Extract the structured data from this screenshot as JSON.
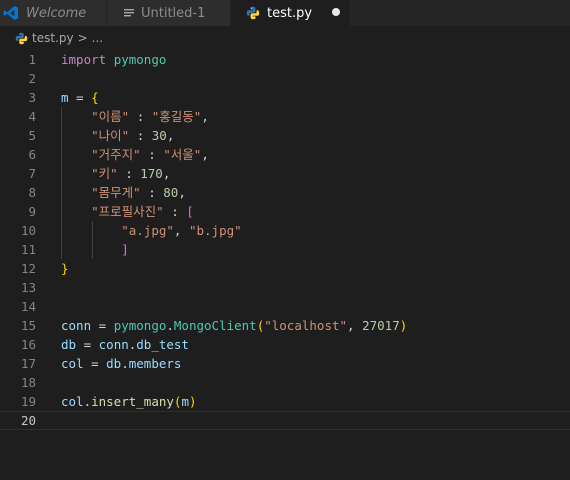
{
  "tabs": [
    {
      "label": "Welcome",
      "icon": "vscode-logo-icon",
      "active": false
    },
    {
      "label": "Untitled-1",
      "icon": "text-file-icon",
      "active": false
    },
    {
      "label": "test.py",
      "icon": "python-icon",
      "active": true,
      "dirty": true
    }
  ],
  "breadcrumb": {
    "file": "test.py",
    "separator": ">",
    "more": "..."
  },
  "editor": {
    "current_line": 20,
    "line_numbers": [
      "1",
      "2",
      "3",
      "4",
      "5",
      "6",
      "7",
      "8",
      "9",
      "10",
      "11",
      "12",
      "13",
      "14",
      "15",
      "16",
      "17",
      "18",
      "19",
      "20"
    ],
    "lines": [
      [
        {
          "t": "import",
          "c": "kw"
        },
        {
          "t": " "
        },
        {
          "t": "pymongo",
          "c": "mod"
        }
      ],
      [],
      [
        {
          "t": "m",
          "c": "var"
        },
        {
          "t": " = ",
          "c": "op"
        },
        {
          "t": "{",
          "c": "b1"
        }
      ],
      [
        {
          "t": "    "
        },
        {
          "t": "\"이름\"",
          "c": "str"
        },
        {
          "t": " : ",
          "c": "op"
        },
        {
          "t": "\"홍길동\"",
          "c": "str"
        },
        {
          "t": ",",
          "c": "op"
        }
      ],
      [
        {
          "t": "    "
        },
        {
          "t": "\"나이\"",
          "c": "str"
        },
        {
          "t": " : ",
          "c": "op"
        },
        {
          "t": "30",
          "c": "num"
        },
        {
          "t": ",",
          "c": "op"
        }
      ],
      [
        {
          "t": "    "
        },
        {
          "t": "\"거주지\"",
          "c": "str"
        },
        {
          "t": " : ",
          "c": "op"
        },
        {
          "t": "\"서울\"",
          "c": "str"
        },
        {
          "t": ",",
          "c": "op"
        }
      ],
      [
        {
          "t": "    "
        },
        {
          "t": "\"키\"",
          "c": "str"
        },
        {
          "t": " : ",
          "c": "op"
        },
        {
          "t": "170",
          "c": "num"
        },
        {
          "t": ",",
          "c": "op"
        }
      ],
      [
        {
          "t": "    "
        },
        {
          "t": "\"몸무게\"",
          "c": "str"
        },
        {
          "t": " : ",
          "c": "op"
        },
        {
          "t": "80",
          "c": "num"
        },
        {
          "t": ",",
          "c": "op"
        }
      ],
      [
        {
          "t": "    "
        },
        {
          "t": "\"프로필사진\"",
          "c": "str"
        },
        {
          "t": " : ",
          "c": "op"
        },
        {
          "t": "[",
          "c": "b2"
        }
      ],
      [
        {
          "t": "        "
        },
        {
          "t": "\"a.jpg\"",
          "c": "str"
        },
        {
          "t": ", ",
          "c": "op"
        },
        {
          "t": "\"b.jpg\"",
          "c": "str"
        }
      ],
      [
        {
          "t": "        "
        },
        {
          "t": "]",
          "c": "b2"
        }
      ],
      [
        {
          "t": "}",
          "c": "b1"
        }
      ],
      [],
      [],
      [
        {
          "t": "conn",
          "c": "var"
        },
        {
          "t": " = ",
          "c": "op"
        },
        {
          "t": "pymongo",
          "c": "mod"
        },
        {
          "t": ".",
          "c": "op"
        },
        {
          "t": "MongoClient",
          "c": "cls"
        },
        {
          "t": "(",
          "c": "b1"
        },
        {
          "t": "\"localhost\"",
          "c": "str"
        },
        {
          "t": ", ",
          "c": "op"
        },
        {
          "t": "27017",
          "c": "num"
        },
        {
          "t": ")",
          "c": "b1"
        }
      ],
      [
        {
          "t": "db",
          "c": "var"
        },
        {
          "t": " = ",
          "c": "op"
        },
        {
          "t": "conn",
          "c": "var"
        },
        {
          "t": ".",
          "c": "op"
        },
        {
          "t": "db_test",
          "c": "var"
        }
      ],
      [
        {
          "t": "col",
          "c": "var"
        },
        {
          "t": " = ",
          "c": "op"
        },
        {
          "t": "db",
          "c": "var"
        },
        {
          "t": ".",
          "c": "op"
        },
        {
          "t": "members",
          "c": "var"
        }
      ],
      [],
      [
        {
          "t": "col",
          "c": "var"
        },
        {
          "t": ".",
          "c": "op"
        },
        {
          "t": "insert_many",
          "c": "fn"
        },
        {
          "t": "(",
          "c": "b1"
        },
        {
          "t": "m",
          "c": "var"
        },
        {
          "t": ")",
          "c": "b1"
        }
      ],
      []
    ]
  },
  "colors": {
    "background": "#1e1e1e",
    "tab_bar": "#252526",
    "inactive_tab": "#2d2d2d",
    "keyword": "#c586c0",
    "string": "#ce9178",
    "number": "#b5cea8",
    "variable": "#9cdcfe",
    "class": "#4ec9b0",
    "function": "#dcdcaa",
    "bracket_level_1": "#ffd700",
    "bracket_level_2": "#da70d6",
    "vscode_blue": "#0078d4",
    "python_blue": "#3572a5",
    "python_yellow": "#ffd43b"
  }
}
